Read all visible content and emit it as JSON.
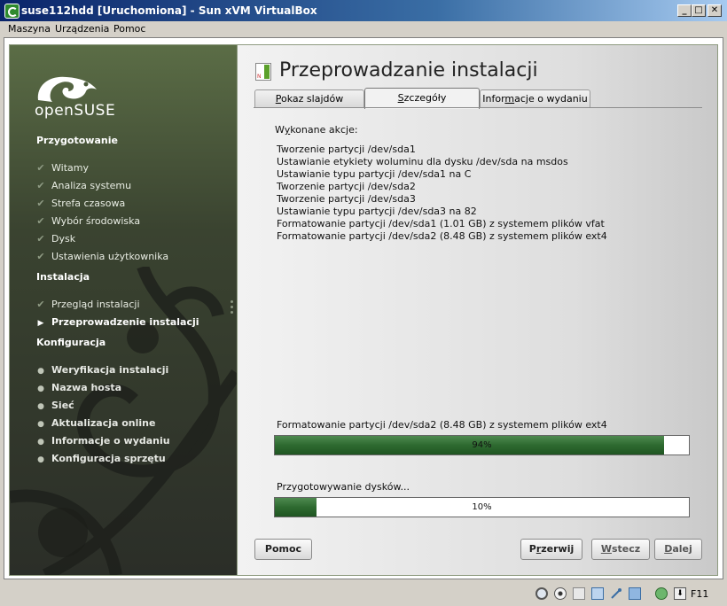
{
  "window": {
    "title": "suse112hdd [Uruchomiona] - Sun xVM VirtualBox"
  },
  "menu": [
    "Maszyna",
    "Urządzenia",
    "Pomoc"
  ],
  "sidebar": {
    "logo_text": "openSUSE",
    "sections": [
      {
        "title": "Przygotowanie",
        "steps": [
          {
            "label": "Witamy",
            "state": "done"
          },
          {
            "label": "Analiza systemu",
            "state": "done"
          },
          {
            "label": "Strefa czasowa",
            "state": "done"
          },
          {
            "label": "Wybór środowiska",
            "state": "done"
          },
          {
            "label": "Dysk",
            "state": "done"
          },
          {
            "label": "Ustawienia użytkownika",
            "state": "done"
          }
        ]
      },
      {
        "title": "Instalacja",
        "steps": [
          {
            "label": "Przegląd instalacji",
            "state": "done"
          },
          {
            "label": "Przeprowadzenie instalacji",
            "state": "current"
          }
        ]
      },
      {
        "title": "Konfiguracja",
        "steps": [
          {
            "label": "Weryfikacja instalacji",
            "state": "todo"
          },
          {
            "label": "Nazwa hosta",
            "state": "todo"
          },
          {
            "label": "Sieć",
            "state": "todo"
          },
          {
            "label": "Aktualizacja online",
            "state": "todo"
          },
          {
            "label": "Informacje o wydaniu",
            "state": "todo"
          },
          {
            "label": "Konfiguracja sprzętu",
            "state": "todo"
          }
        ]
      }
    ]
  },
  "main": {
    "title": "Przeprowadzanie instalacji",
    "tabs": [
      {
        "pre": "",
        "mn": "P",
        "post": "okaz slajdów"
      },
      {
        "pre": "",
        "mn": "S",
        "post": "zczegóły"
      },
      {
        "pre": "Infor",
        "mn": "m",
        "post": "acje o wydaniu"
      }
    ],
    "active_tab": 1,
    "done_label": {
      "pre": "W",
      "mn": "y",
      "post": "konane akcje:"
    },
    "actions": [
      "Tworzenie partycji /dev/sda1",
      "Ustawianie etykiety woluminu dla dysku /dev/sda na msdos",
      "Ustawianie typu partycji /dev/sda1 na C",
      "Tworzenie partycji /dev/sda2",
      "Tworzenie partycji /dev/sda3",
      "Ustawianie typu partycji /dev/sda3 na 82",
      "Formatowanie partycji /dev/sda1 (1.01 GB) z systemem plików vfat",
      "Formatowanie partycji /dev/sda2 (8.48 GB) z systemem plików ext4"
    ],
    "progress1": {
      "label": "Formatowanie partycji /dev/sda2 (8.48 GB) z systemem plików ext4",
      "percent": 94,
      "text": "94%"
    },
    "progress2": {
      "label": "Przygotowywanie dysków...",
      "percent": 10,
      "text": "10%"
    },
    "buttons": {
      "help": "Pomoc",
      "abort": {
        "pre": "P",
        "mn": "r",
        "post": "zerwij"
      },
      "back": {
        "pre": "",
        "mn": "W",
        "post": "stecz"
      },
      "next": {
        "pre": "",
        "mn": "D",
        "post": "alej"
      }
    }
  },
  "statusbar": {
    "host_key": "F11"
  }
}
